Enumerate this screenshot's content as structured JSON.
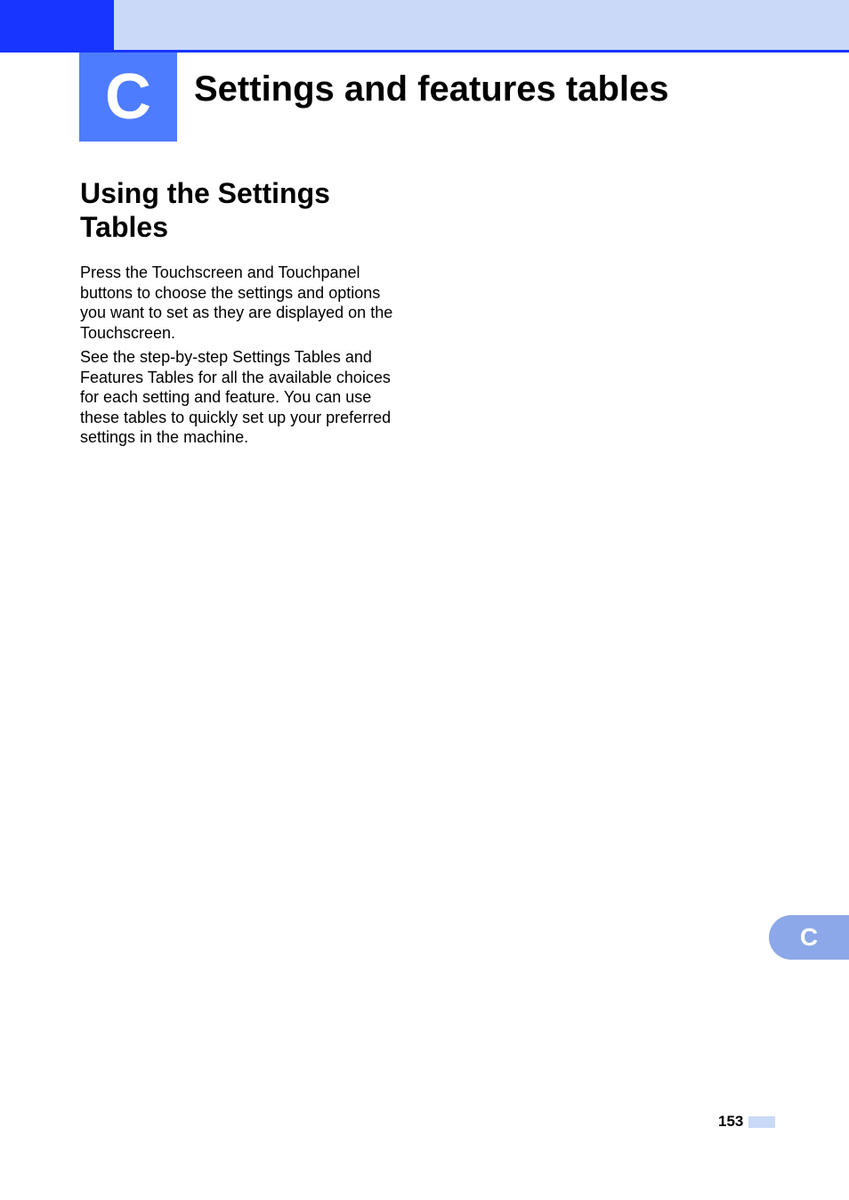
{
  "chapter": {
    "letter": "C",
    "title": "Settings and features tables"
  },
  "section": {
    "heading": "Using the Settings Tables"
  },
  "paragraphs": {
    "p1": "Press the Touchscreen and Touchpanel buttons to choose the settings and options you want to set as they are displayed on the Touchscreen.",
    "p2": "See the step-by-step Settings Tables and Features Tables for all the available choices for each setting and feature. You can use these tables to quickly set up your preferred settings in the machine."
  },
  "sideTab": {
    "letter": "C"
  },
  "footer": {
    "pageNumber": "153"
  }
}
